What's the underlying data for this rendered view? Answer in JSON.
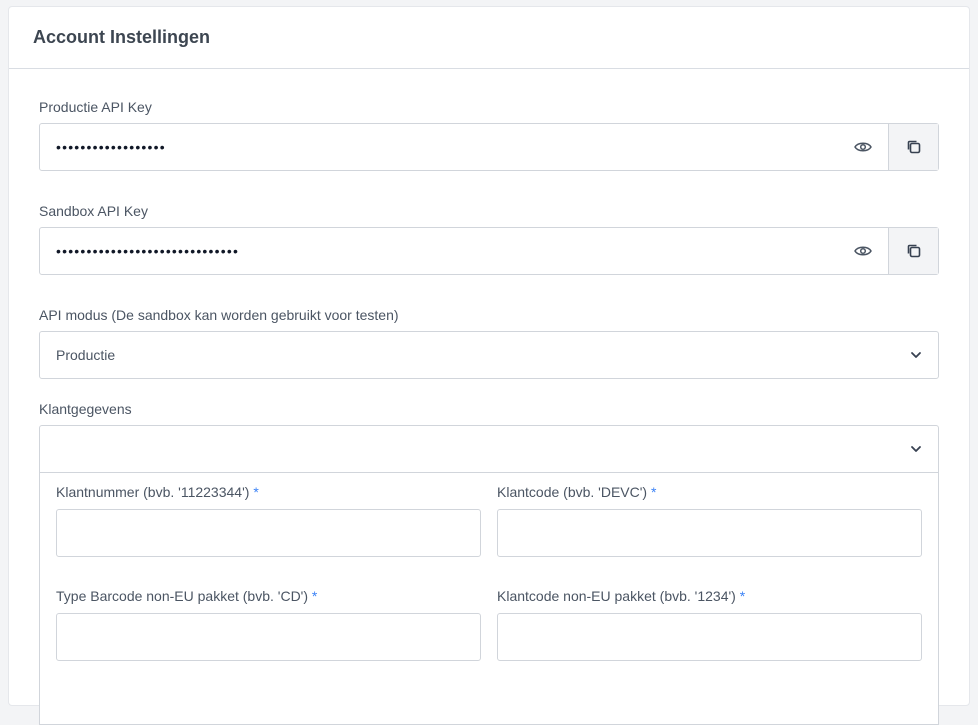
{
  "card": {
    "title": "Account Instellingen"
  },
  "production_key": {
    "label": "Productie API Key",
    "masked_value": "••••••••••••••••••"
  },
  "sandbox_key": {
    "label": "Sandbox API Key",
    "masked_value": "••••••••••••••••••••••••••••••"
  },
  "api_mode": {
    "label": "API modus (De sandbox kan worden gebruikt voor testen)",
    "selected": "Productie"
  },
  "customer": {
    "label": "Klantgegevens",
    "fields": [
      {
        "label": "Klantnummer (bvb. '11223344')",
        "required": "*",
        "value": ""
      },
      {
        "label": "Klantcode (bvb. 'DEVC')",
        "required": "*",
        "value": ""
      },
      {
        "label": "Type Barcode non-EU pakket (bvb. 'CD')",
        "required": "*",
        "value": ""
      },
      {
        "label": "Klantcode non-EU pakket (bvb. '1234')",
        "required": "*",
        "value": ""
      }
    ]
  },
  "colors": {
    "accent": "#3b82f6",
    "border": "#d1d5db",
    "addon_bg": "#f3f4f6"
  },
  "icons": {
    "show": "eye-icon",
    "copy": "copy-icon",
    "dropdown": "chevron-down-icon"
  }
}
